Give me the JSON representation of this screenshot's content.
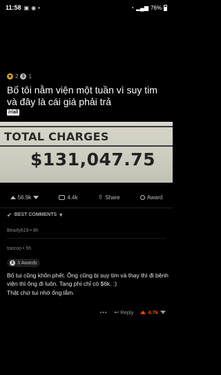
{
  "status_bar": {
    "time": "11:58",
    "battery": "76%"
  },
  "post": {
    "awards": [
      {
        "icon": "gold-award-icon",
        "count": "2"
      },
      {
        "icon": "silver-award-icon",
        "count": "1"
      }
    ],
    "title": "Bố tôi nằm viện một tuần vì suy tim và đây là cái giá phải trả",
    "subreddit": "/r/all",
    "image": {
      "label": "TOTAL CHARGES",
      "amount": "$131,047.75"
    },
    "actions": {
      "score": "56.9k",
      "comments": "4.4k",
      "share": "Share",
      "award": "Award"
    }
  },
  "comments": {
    "sort_label": "BEST COMMENTS",
    "items": [
      {
        "author": "Bearly619",
        "age": "8h",
        "collapsed": true
      },
      {
        "author": "toocoo",
        "age": "5h",
        "awards_label": "3 Awards",
        "lines": [
          "Bố tui cũng khôn phết. Ông cũng bị suy tim và thay thì đi bệnh viện thì ông đi luôn. Tang phí chỉ có $6k. :)",
          "Thật chứ tui nhớ ổng lắm."
        ],
        "reply_label": "Reply",
        "score": "4.7k"
      }
    ]
  },
  "colors": {
    "background": "#000000",
    "upvote_accent": "#ff4500"
  }
}
